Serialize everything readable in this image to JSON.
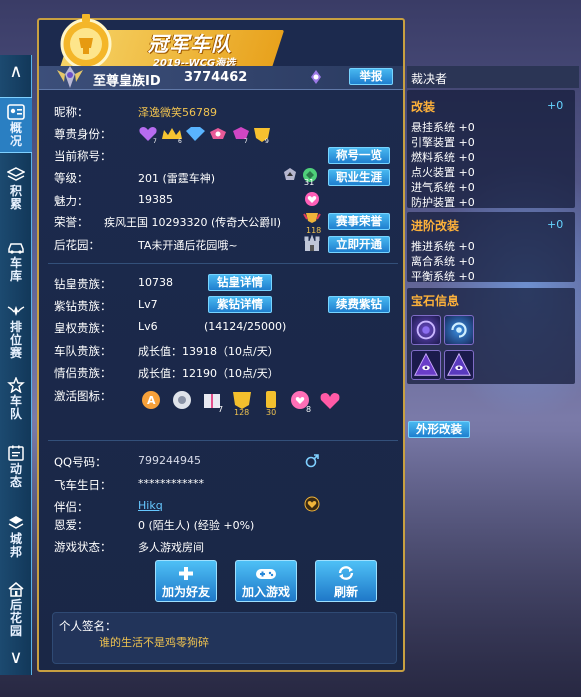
{
  "nav": {
    "up": "∧",
    "down": "∨",
    "items": [
      {
        "label": "概况",
        "icon": "profile-card-icon"
      },
      {
        "label": "积累",
        "icon": "layers-icon"
      },
      {
        "label": "车库",
        "icon": "car-icon"
      },
      {
        "label": "排位赛",
        "icon": "rank-wings-icon"
      },
      {
        "label": "车队",
        "icon": "team-star-icon"
      },
      {
        "label": "动态",
        "icon": "calendar-news-icon"
      },
      {
        "label": "城邦",
        "icon": "city-layers-icon"
      },
      {
        "label": "后花园",
        "icon": "garden-house-icon"
      }
    ]
  },
  "banner": {
    "title": "冠军车队",
    "subtitle": "2019--WCG海选"
  },
  "idbar": {
    "label": "至尊皇族ID",
    "id": "3774462",
    "report_label": "举报"
  },
  "profile": {
    "nickname_label": "昵称：",
    "nickname": "泽逸微笑56789",
    "noble_label": "尊贵身份：",
    "title_label": "当前称号：",
    "title_list_btn": "称号一览",
    "level_label": "等级：",
    "level": "201 (雷霆车神)",
    "career_btn": "职业生涯",
    "level_badge": "31",
    "charm_label": "魅力：",
    "charm": "19385",
    "honor_label": "荣誉：",
    "honor": "疾风王国 10293320 (传奇大公爵II)",
    "honor_btn": "赛事荣誉",
    "honor_badge": "118",
    "garden_label": "后花园：",
    "garden": "TA未开通后花园哦~",
    "garden_btn": "立即开通"
  },
  "nobility": {
    "diamond_label": "钻皇贵族：",
    "diamond": "10738",
    "diamond_btn": "钻皇详情",
    "purple_label": "紫钻贵族：",
    "purple": "Lv7",
    "purple_btn": "紫钻详情",
    "renew_btn": "续费紫钻",
    "royal_label": "皇权贵族：",
    "royal": "Lv6",
    "royal_progress": "(14124/25000)",
    "team_label": "车队贵族：",
    "team": "成长值：13918（10点/天）",
    "couple_label": "情侣贵族：",
    "couple": "成长值：12190（10点/天）",
    "activate_label": "激活图标：",
    "activate_badges": [
      "7",
      "128",
      "30",
      "8"
    ]
  },
  "info": {
    "qq_label": "QQ号码：",
    "qq": "799244945",
    "birthday_label": "飞车生日：",
    "birthday": "************",
    "partner_label": "伴侣：",
    "partner": "Hikq",
    "love_label": "恩爱：",
    "love": "0 (陌生人) (经验 +0%)",
    "status_label": "游戏状态：",
    "status": "多人游戏房间"
  },
  "actions": {
    "add_friend": "加为好友",
    "join_game": "加入游戏",
    "refresh": "刷新"
  },
  "signature": {
    "label": "个人签名：",
    "text": "谁的生活不是鸡零狗碎"
  },
  "right": {
    "car_name": "裁决者",
    "mod_title": "改装",
    "mod_plus": "+0",
    "mods": [
      "悬挂系统 +0",
      "引擎装置 +0",
      "燃料系统 +0",
      "点火装置 +0",
      "进气系统 +0",
      "防护装置 +0"
    ],
    "adv_title": "进阶改装",
    "adv_plus": "+0",
    "adv": [
      "推进系统 +0",
      "离合系统 +0",
      "平衡系统 +0"
    ],
    "gem_title": "宝石信息",
    "appearance_btn": "外形改装"
  },
  "colors": {
    "accent_gold": "#f0c350",
    "section_orange": "#ffb23a",
    "button_blue": "#2a8fdc",
    "panel_border": "#c8a041"
  }
}
